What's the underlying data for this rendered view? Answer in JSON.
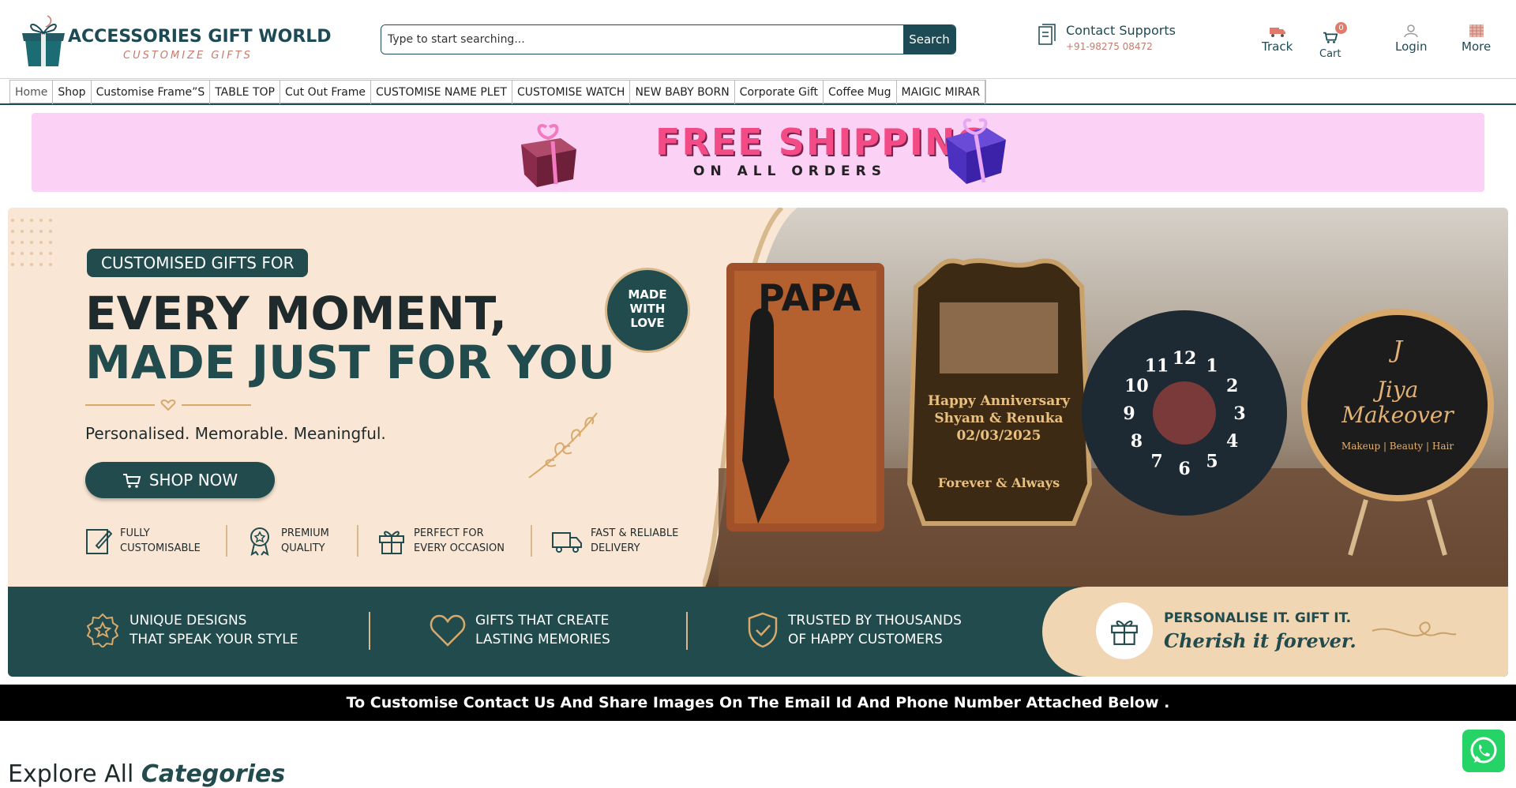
{
  "header": {
    "logo_title": "ACCESSORIES GIFT WORLD",
    "logo_subtitle": "CUSTOMIZE GIFTS",
    "search_placeholder": "Type to start searching...",
    "search_button": "Search",
    "contact_title": "Contact Supports",
    "contact_phone": "+91-98275 08472",
    "track_label": "Track",
    "cart_label": "Cart",
    "cart_count": "0",
    "login_label": "Login",
    "more_label": "More"
  },
  "nav": {
    "items": [
      "Home",
      "Shop",
      "Customise Frame”S",
      "TABLE TOP",
      "Cut Out Frame",
      "CUSTOMISE NAME PLET",
      "CUSTOMISE WATCH",
      "NEW BABY BORN",
      "Corporate Gift",
      "Coffee Mug",
      "MAIGIC MIRAR"
    ]
  },
  "shipping_banner": {
    "title": "FREE SHIPPING",
    "subtitle": "ON ALL ORDERS"
  },
  "hero": {
    "pill": "CUSTOMISED GIFTS FOR",
    "headline_1": "EVERY MOMENT,",
    "headline_2": "MADE JUST FOR YOU",
    "tagline": "Personalised. Memorable. Meaningful.",
    "cta": "SHOP NOW",
    "badge_1": "MADE",
    "badge_2": "WITH",
    "badge_3": "LOVE",
    "features": [
      {
        "line1": "FULLY",
        "line2": "CUSTOMISABLE"
      },
      {
        "line1": "PREMIUM",
        "line2": "QUALITY"
      },
      {
        "line1": "PERFECT FOR",
        "line2": "EVERY OCCASION"
      },
      {
        "line1": "FAST & RELIABLE",
        "line2": "DELIVERY"
      }
    ],
    "bottom": [
      {
        "line1": "UNIQUE DESIGNS",
        "line2": "THAT SPEAK YOUR STYLE"
      },
      {
        "line1": "GIFTS THAT CREATE",
        "line2": "LASTING MEMORIES"
      },
      {
        "line1": "TRUSTED BY THOUSANDS",
        "line2": "OF HAPPY CUSTOMERS"
      }
    ],
    "personalise_1": "PERSONALISE IT. GIFT IT.",
    "personalise_2": "Cherish it forever.",
    "products": {
      "frame_title": "PAPA",
      "plaque_1": "Happy Anniversary",
      "plaque_2": "Shyam & Renuka",
      "plaque_3": "02/03/2025",
      "plaque_4": "Forever & Always",
      "clock_numbers": [
        "12",
        "1",
        "2",
        "3",
        "4",
        "5",
        "6",
        "7",
        "8",
        "9",
        "10",
        "11"
      ],
      "sign_letter": "J",
      "sign_name_1": "Jiya",
      "sign_name_2": "Makeover",
      "sign_sub": "Makeup | Beauty | Hair"
    }
  },
  "notice": "To Customise Contact Us And Share Images On The Email Id And Phone Number Attached Below .",
  "explore": {
    "word1": "Explore All",
    "word2": "Categories"
  },
  "colors": {
    "brand": "#1c4a55",
    "accent": "#c97a6d",
    "hero_teal": "#214b4d",
    "shipping_pink": "#fbd2f5",
    "whatsapp": "#25d366"
  }
}
